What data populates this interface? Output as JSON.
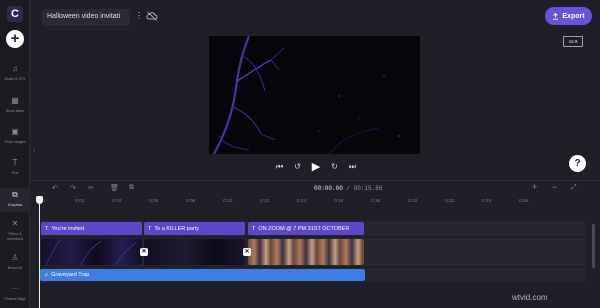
{
  "app": {
    "logo_letter": "C"
  },
  "header": {
    "project_title": "Halloween video invitati",
    "kebab": "⋮",
    "export_label": "Export",
    "aspect_ratio": "16:9"
  },
  "sidebar": {
    "add_label": "+",
    "items": [
      {
        "icon": "♫",
        "label": "Music & SFX",
        "active": false
      },
      {
        "icon": "▦",
        "label": "Stock video",
        "active": false
      },
      {
        "icon": "▣",
        "label": "Stock images",
        "active": false
      },
      {
        "icon": "T",
        "label": "Text",
        "active": false
      },
      {
        "icon": "⧉",
        "label": "Graphics",
        "active": true
      },
      {
        "icon": "✕",
        "label": "Filters & transitions",
        "active": false
      },
      {
        "icon": "♙",
        "label": "Brand kit",
        "active": false
      },
      {
        "icon": "···",
        "label": "Feature flags",
        "active": false
      }
    ]
  },
  "playback": {
    "skip_back": "⏮",
    "rewind": "↺",
    "play": "▶",
    "forward": "↻",
    "skip_forward": "⏭"
  },
  "help_label": "?",
  "timeline": {
    "current_time": "00:00.00",
    "separator": " / ",
    "duration": "00:15.86",
    "zoom_in": "+",
    "zoom_out": "−",
    "fit": "⤢",
    "ruler": [
      "0",
      "0:02",
      "0:04",
      "0:06",
      "0:08",
      "0:10",
      "0:12",
      "0:14",
      "0:16",
      "0:18",
      "0:20",
      "0:22",
      "0:24",
      "0:26"
    ],
    "text_clips": [
      {
        "label": "You're invited"
      },
      {
        "label": "To a KILLER party"
      },
      {
        "label": "ON ZOOM @ 7 PM 31ST OCTOBER"
      }
    ],
    "audio_clip": {
      "label": "Graveyard Trap"
    }
  },
  "watermark": "wtvid.com",
  "colors": {
    "accent": "#6b52d9",
    "text_clip": "#5c47c8",
    "audio_clip": "#3f7de4",
    "background": "#1f1f27"
  }
}
